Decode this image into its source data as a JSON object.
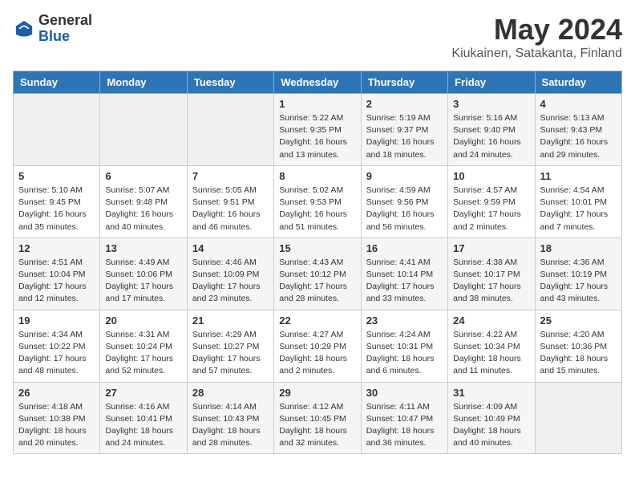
{
  "header": {
    "logo_general": "General",
    "logo_blue": "Blue",
    "month_title": "May 2024",
    "location": "Kiukainen, Satakanta, Finland"
  },
  "days_of_week": [
    "Sunday",
    "Monday",
    "Tuesday",
    "Wednesday",
    "Thursday",
    "Friday",
    "Saturday"
  ],
  "weeks": [
    [
      {
        "day": "",
        "info": ""
      },
      {
        "day": "",
        "info": ""
      },
      {
        "day": "",
        "info": ""
      },
      {
        "day": "1",
        "info": "Sunrise: 5:22 AM\nSunset: 9:35 PM\nDaylight: 16 hours\nand 13 minutes."
      },
      {
        "day": "2",
        "info": "Sunrise: 5:19 AM\nSunset: 9:37 PM\nDaylight: 16 hours\nand 18 minutes."
      },
      {
        "day": "3",
        "info": "Sunrise: 5:16 AM\nSunset: 9:40 PM\nDaylight: 16 hours\nand 24 minutes."
      },
      {
        "day": "4",
        "info": "Sunrise: 5:13 AM\nSunset: 9:43 PM\nDaylight: 16 hours\nand 29 minutes."
      }
    ],
    [
      {
        "day": "5",
        "info": "Sunrise: 5:10 AM\nSunset: 9:45 PM\nDaylight: 16 hours\nand 35 minutes."
      },
      {
        "day": "6",
        "info": "Sunrise: 5:07 AM\nSunset: 9:48 PM\nDaylight: 16 hours\nand 40 minutes."
      },
      {
        "day": "7",
        "info": "Sunrise: 5:05 AM\nSunset: 9:51 PM\nDaylight: 16 hours\nand 46 minutes."
      },
      {
        "day": "8",
        "info": "Sunrise: 5:02 AM\nSunset: 9:53 PM\nDaylight: 16 hours\nand 51 minutes."
      },
      {
        "day": "9",
        "info": "Sunrise: 4:59 AM\nSunset: 9:56 PM\nDaylight: 16 hours\nand 56 minutes."
      },
      {
        "day": "10",
        "info": "Sunrise: 4:57 AM\nSunset: 9:59 PM\nDaylight: 17 hours\nand 2 minutes."
      },
      {
        "day": "11",
        "info": "Sunrise: 4:54 AM\nSunset: 10:01 PM\nDaylight: 17 hours\nand 7 minutes."
      }
    ],
    [
      {
        "day": "12",
        "info": "Sunrise: 4:51 AM\nSunset: 10:04 PM\nDaylight: 17 hours\nand 12 minutes."
      },
      {
        "day": "13",
        "info": "Sunrise: 4:49 AM\nSunset: 10:06 PM\nDaylight: 17 hours\nand 17 minutes."
      },
      {
        "day": "14",
        "info": "Sunrise: 4:46 AM\nSunset: 10:09 PM\nDaylight: 17 hours\nand 23 minutes."
      },
      {
        "day": "15",
        "info": "Sunrise: 4:43 AM\nSunset: 10:12 PM\nDaylight: 17 hours\nand 28 minutes."
      },
      {
        "day": "16",
        "info": "Sunrise: 4:41 AM\nSunset: 10:14 PM\nDaylight: 17 hours\nand 33 minutes."
      },
      {
        "day": "17",
        "info": "Sunrise: 4:38 AM\nSunset: 10:17 PM\nDaylight: 17 hours\nand 38 minutes."
      },
      {
        "day": "18",
        "info": "Sunrise: 4:36 AM\nSunset: 10:19 PM\nDaylight: 17 hours\nand 43 minutes."
      }
    ],
    [
      {
        "day": "19",
        "info": "Sunrise: 4:34 AM\nSunset: 10:22 PM\nDaylight: 17 hours\nand 48 minutes."
      },
      {
        "day": "20",
        "info": "Sunrise: 4:31 AM\nSunset: 10:24 PM\nDaylight: 17 hours\nand 52 minutes."
      },
      {
        "day": "21",
        "info": "Sunrise: 4:29 AM\nSunset: 10:27 PM\nDaylight: 17 hours\nand 57 minutes."
      },
      {
        "day": "22",
        "info": "Sunrise: 4:27 AM\nSunset: 10:29 PM\nDaylight: 18 hours\nand 2 minutes."
      },
      {
        "day": "23",
        "info": "Sunrise: 4:24 AM\nSunset: 10:31 PM\nDaylight: 18 hours\nand 6 minutes."
      },
      {
        "day": "24",
        "info": "Sunrise: 4:22 AM\nSunset: 10:34 PM\nDaylight: 18 hours\nand 11 minutes."
      },
      {
        "day": "25",
        "info": "Sunrise: 4:20 AM\nSunset: 10:36 PM\nDaylight: 18 hours\nand 15 minutes."
      }
    ],
    [
      {
        "day": "26",
        "info": "Sunrise: 4:18 AM\nSunset: 10:38 PM\nDaylight: 18 hours\nand 20 minutes."
      },
      {
        "day": "27",
        "info": "Sunrise: 4:16 AM\nSunset: 10:41 PM\nDaylight: 18 hours\nand 24 minutes."
      },
      {
        "day": "28",
        "info": "Sunrise: 4:14 AM\nSunset: 10:43 PM\nDaylight: 18 hours\nand 28 minutes."
      },
      {
        "day": "29",
        "info": "Sunrise: 4:12 AM\nSunset: 10:45 PM\nDaylight: 18 hours\nand 32 minutes."
      },
      {
        "day": "30",
        "info": "Sunrise: 4:11 AM\nSunset: 10:47 PM\nDaylight: 18 hours\nand 36 minutes."
      },
      {
        "day": "31",
        "info": "Sunrise: 4:09 AM\nSunset: 10:49 PM\nDaylight: 18 hours\nand 40 minutes."
      },
      {
        "day": "",
        "info": ""
      }
    ]
  ]
}
